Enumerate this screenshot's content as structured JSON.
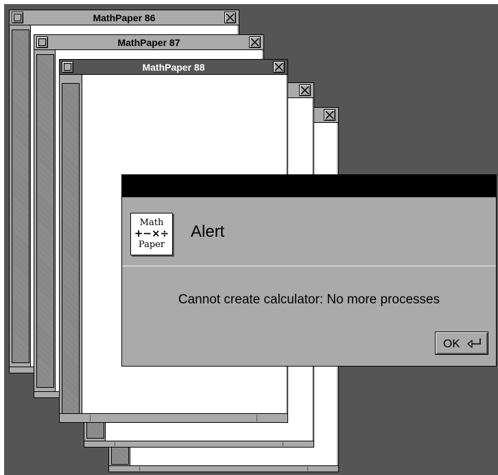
{
  "windows": [
    {
      "title": "MathPaper 86"
    },
    {
      "title": "MathPaper 87"
    },
    {
      "title": "MathPaper 88"
    },
    {
      "title": ""
    },
    {
      "title": ""
    }
  ],
  "alert": {
    "icon_text": {
      "line1": "Math",
      "line2": "+−×÷",
      "line3": "Paper"
    },
    "title": "Alert",
    "message": "Cannot create calculator: No more processes",
    "ok_label": "OK"
  },
  "colors": {
    "desktop": "#555555",
    "window": "#aaaaaa",
    "active_titlebar": "#555555",
    "alert_titlebar": "#000000"
  },
  "icons": [
    "miniaturize-icon",
    "close-icon",
    "return-key-icon"
  ]
}
